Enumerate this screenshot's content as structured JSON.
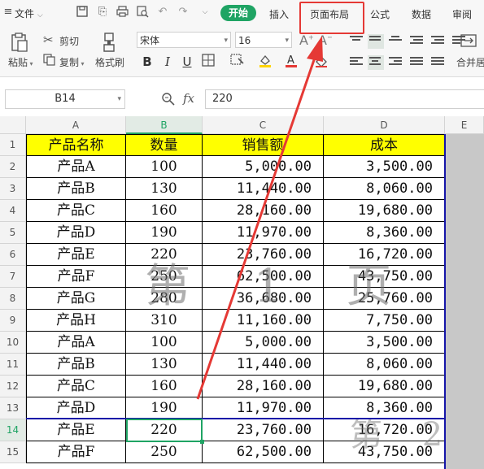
{
  "toolbar": {
    "file_label": "文件",
    "tabs": [
      "开始",
      "插入",
      "页面布局",
      "公式",
      "数据",
      "审阅"
    ],
    "clipboard": {
      "paste": "粘贴",
      "cut": "剪切",
      "copy": "复制",
      "format_painter": "格式刷"
    },
    "font_name": "宋体",
    "font_size": "16",
    "merge_label": "合并居"
  },
  "formula_bar": {
    "cell_ref": "B14",
    "fx": "fx",
    "value": "220"
  },
  "sheet": {
    "columns": [
      "A",
      "B",
      "C",
      "D",
      "E"
    ],
    "rows": [
      [
        "1",
        "产品名称",
        "数量",
        "销售额",
        "成本"
      ],
      [
        "2",
        "产品A",
        "100",
        "5,000.00",
        "3,500.00"
      ],
      [
        "3",
        "产品B",
        "130",
        "11,440.00",
        "8,060.00"
      ],
      [
        "4",
        "产品C",
        "160",
        "28,160.00",
        "19,680.00"
      ],
      [
        "5",
        "产品D",
        "190",
        "11,970.00",
        "8,360.00"
      ],
      [
        "6",
        "产品E",
        "220",
        "23,760.00",
        "16,720.00"
      ],
      [
        "7",
        "产品F",
        "250",
        "62,500.00",
        "43,750.00"
      ],
      [
        "8",
        "产品G",
        "280",
        "36,680.00",
        "25,760.00"
      ],
      [
        "9",
        "产品H",
        "310",
        "11,160.00",
        "7,750.00"
      ],
      [
        "10",
        "产品A",
        "100",
        "5,000.00",
        "3,500.00"
      ],
      [
        "11",
        "产品B",
        "130",
        "11,440.00",
        "8,060.00"
      ],
      [
        "12",
        "产品C",
        "160",
        "28,160.00",
        "19,680.00"
      ],
      [
        "13",
        "产品D",
        "190",
        "11,970.00",
        "8,360.00"
      ],
      [
        "14",
        "产品E",
        "220",
        "23,760.00",
        "16,720.00"
      ],
      [
        "15",
        "产品F",
        "250",
        "62,500.00",
        "43,750.00"
      ]
    ],
    "watermark": "第 1 页",
    "page_break_watermark": "第 2 页"
  },
  "colors": {
    "accent": "#1fa464",
    "header_fill": "#ffff00",
    "page_break": "#1515a8",
    "annotation": "#e53935"
  }
}
